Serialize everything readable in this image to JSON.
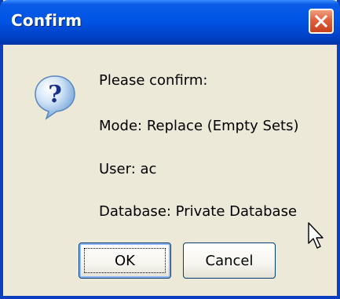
{
  "window": {
    "title": "Confirm",
    "close_icon": "close-icon"
  },
  "icon": "question-icon",
  "message": {
    "line1": "Please confirm:",
    "mode": "Mode: Replace (Empty Sets)",
    "user": "User: ac",
    "database": "Database: Private Database"
  },
  "buttons": {
    "ok_label": "OK",
    "cancel_label": "Cancel"
  },
  "colors": {
    "titlebar": "#0055e5",
    "dialog_bg": "#ece9d8",
    "close_button": "#e0603a"
  }
}
